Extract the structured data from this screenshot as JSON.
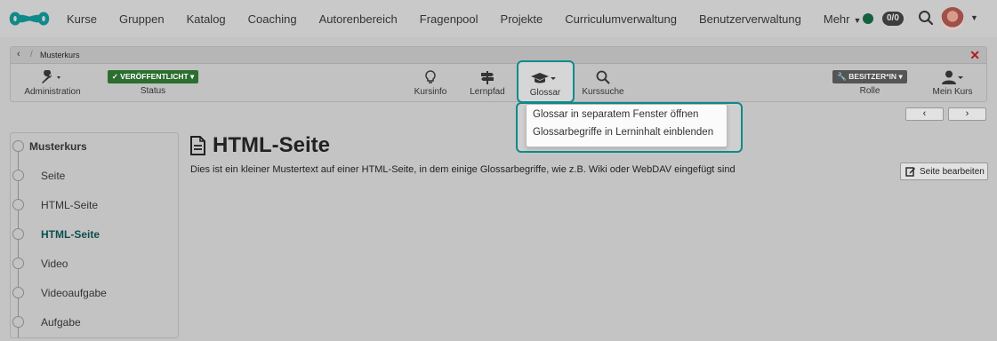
{
  "topnav": {
    "items": [
      "Kurse",
      "Gruppen",
      "Katalog",
      "Coaching",
      "Autorenbereich",
      "Fragenpool",
      "Projekte",
      "Curriculumverwaltung",
      "Benutzerverwaltung",
      "Mehr"
    ],
    "badge_count": "0/0",
    "status_color": "#14613d"
  },
  "breadcrumb": {
    "course": "Musterkurs"
  },
  "toolbar": {
    "administration": "Administration",
    "published": "VERÖFFENTLICHT",
    "status": "Status",
    "kursinfo": "Kursinfo",
    "lernpfad": "Lernpfad",
    "glossar": "Glossar",
    "kurssuche": "Kurssuche",
    "role_badge": "BESITZER*IN",
    "rolle": "Rolle",
    "mein_kurs": "Mein Kurs"
  },
  "glossar_menu": {
    "items": [
      "Glossar in separatem Fenster öffnen",
      "Glossarbegriffe in Lerninhalt einblenden"
    ]
  },
  "menu": {
    "root": "Musterkurs",
    "items": [
      "Seite",
      "HTML-Seite",
      "HTML-Seite",
      "Video",
      "Videoaufgabe",
      "Aufgabe"
    ],
    "active_index": 2
  },
  "content": {
    "title": "HTML-Seite",
    "text": "Dies ist ein kleiner Mustertext auf einer HTML-Seite, in dem einige Glossarbegriffe, wie z.B. Wiki oder WebDAV eingefügt sind",
    "edit_button": "Seite bearbeiten"
  },
  "colors": {
    "accent": "#0f8a8a",
    "published": "#2b6e2f"
  }
}
